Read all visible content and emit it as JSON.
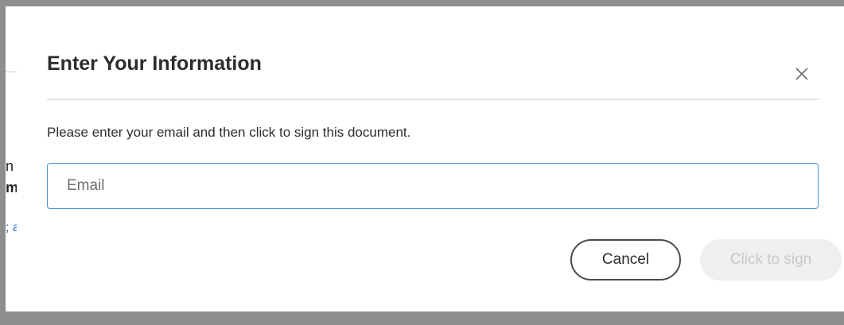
{
  "background": {
    "fragments": [
      "n I",
      "m",
      "; a"
    ]
  },
  "modal": {
    "title": "Enter Your Information",
    "close_icon": "close-icon",
    "instructions": "Please enter your email and then click to sign this document.",
    "email": {
      "placeholder": "Email",
      "value": ""
    },
    "buttons": {
      "cancel_label": "Cancel",
      "sign_label": "Click to sign",
      "sign_disabled": true
    }
  },
  "colors": {
    "input_focus_border": "#4a90d9",
    "disabled_button_bg": "#efefef",
    "disabled_button_text": "#c8c8c8"
  }
}
